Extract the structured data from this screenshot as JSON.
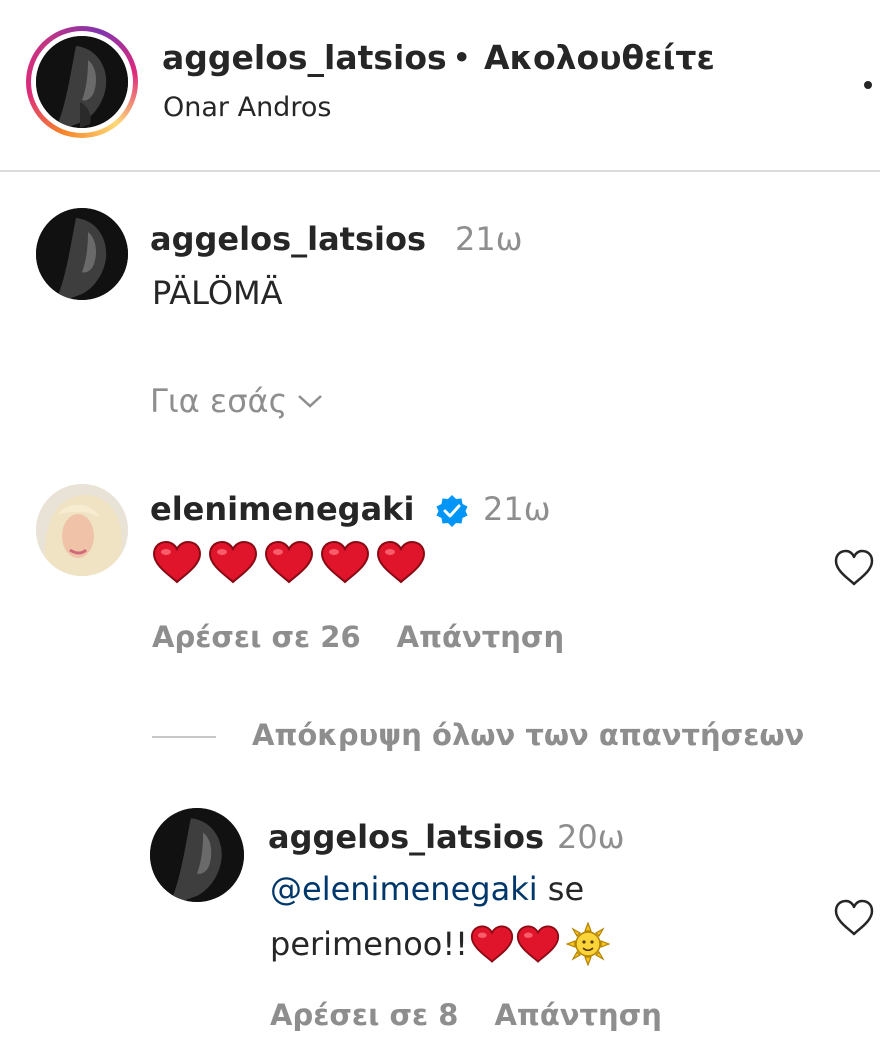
{
  "header": {
    "username": "aggelos_latsios",
    "separator": "•",
    "follow_status": "Ακολουθείτε",
    "location": "Onar Andros",
    "more_icon": "more-options-icon"
  },
  "caption": {
    "username": "aggelos_latsios",
    "time": "21ω",
    "text": "PÄLÖMÄ"
  },
  "filter": {
    "label": "Για εσάς",
    "icon": "chevron-down-icon"
  },
  "comment": {
    "username": "elenimenegaki",
    "verified": true,
    "time": "21ω",
    "emoji": [
      "red-heart",
      "red-heart",
      "red-heart",
      "red-heart",
      "red-heart"
    ],
    "likes_label": "Αρέσει σε 26",
    "reply_label": "Απάντηση"
  },
  "hide_replies": {
    "label": "Απόκρυψη όλων των απαντήσεων"
  },
  "reply": {
    "username": "aggelos_latsios",
    "time": "20ω",
    "mention": "@elenimenegaki",
    "text_after_mention": " se",
    "text_line2": "perimenoo!!",
    "emoji": [
      "red-heart",
      "red-heart",
      "sun-with-face"
    ],
    "likes_label": "Αρέσει σε 8",
    "reply_label": "Απάντηση"
  },
  "colors": {
    "primary_text": "#262626",
    "secondary_text": "#8e8e8e",
    "mention": "#00376b",
    "verified_badge": "#0095f6",
    "heart_emoji": "#e0142a"
  }
}
